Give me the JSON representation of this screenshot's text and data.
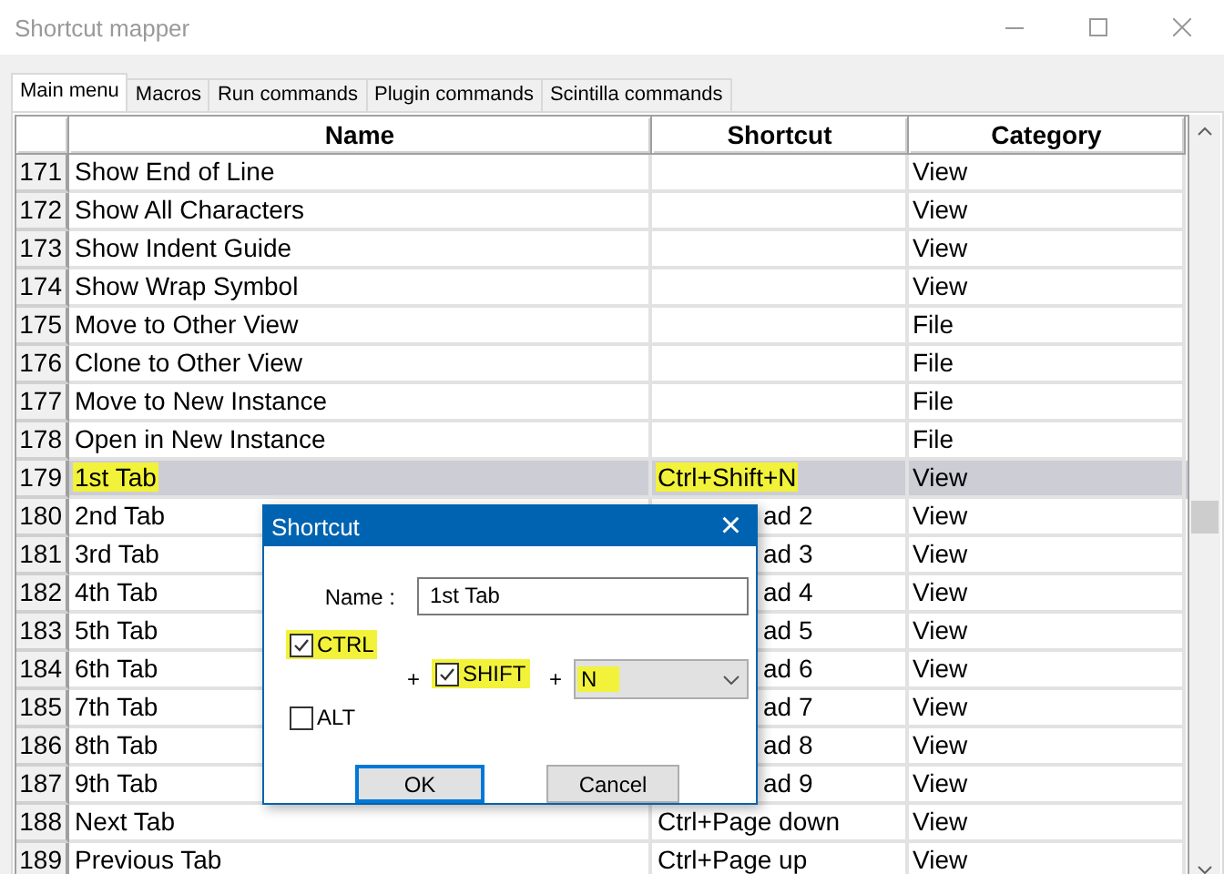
{
  "window": {
    "title": "Shortcut mapper"
  },
  "tabs": [
    {
      "label": "Main menu",
      "selected": true
    },
    {
      "label": "Macros",
      "selected": false
    },
    {
      "label": "Run commands",
      "selected": false
    },
    {
      "label": "Plugin commands",
      "selected": false
    },
    {
      "label": "Scintilla commands",
      "selected": false
    }
  ],
  "table": {
    "columns": [
      "Name",
      "Shortcut",
      "Category"
    ],
    "rows": [
      {
        "number": "171",
        "name": "Show End of Line",
        "shortcut": "",
        "category": "View",
        "selected": false,
        "highlighted": false,
        "covered": false
      },
      {
        "number": "172",
        "name": "Show All Characters",
        "shortcut": "",
        "category": "View",
        "selected": false,
        "highlighted": false,
        "covered": false
      },
      {
        "number": "173",
        "name": "Show Indent Guide",
        "shortcut": "",
        "category": "View",
        "selected": false,
        "highlighted": false,
        "covered": false
      },
      {
        "number": "174",
        "name": "Show Wrap Symbol",
        "shortcut": "",
        "category": "View",
        "selected": false,
        "highlighted": false,
        "covered": false
      },
      {
        "number": "175",
        "name": "Move to Other View",
        "shortcut": "",
        "category": "File",
        "selected": false,
        "highlighted": false,
        "covered": false
      },
      {
        "number": "176",
        "name": "Clone to Other View",
        "shortcut": "",
        "category": "File",
        "selected": false,
        "highlighted": false,
        "covered": false
      },
      {
        "number": "177",
        "name": "Move to New Instance",
        "shortcut": "",
        "category": "File",
        "selected": false,
        "highlighted": false,
        "covered": false
      },
      {
        "number": "178",
        "name": "Open in New Instance",
        "shortcut": "",
        "category": "File",
        "selected": false,
        "highlighted": false,
        "covered": false
      },
      {
        "number": "179",
        "name": "1st Tab",
        "shortcut": "Ctrl+Shift+N",
        "category": "View",
        "selected": true,
        "highlighted": true,
        "covered": false
      },
      {
        "number": "180",
        "name": "2nd Tab",
        "shortcut": "ad 2",
        "category": "View",
        "selected": false,
        "highlighted": false,
        "covered": true
      },
      {
        "number": "181",
        "name": "3rd Tab",
        "shortcut": "ad 3",
        "category": "View",
        "selected": false,
        "highlighted": false,
        "covered": true
      },
      {
        "number": "182",
        "name": "4th Tab",
        "shortcut": "ad 4",
        "category": "View",
        "selected": false,
        "highlighted": false,
        "covered": true
      },
      {
        "number": "183",
        "name": "5th Tab",
        "shortcut": "ad 5",
        "category": "View",
        "selected": false,
        "highlighted": false,
        "covered": true
      },
      {
        "number": "184",
        "name": "6th Tab",
        "shortcut": "ad 6",
        "category": "View",
        "selected": false,
        "highlighted": false,
        "covered": true
      },
      {
        "number": "185",
        "name": "7th Tab",
        "shortcut": "ad 7",
        "category": "View",
        "selected": false,
        "highlighted": false,
        "covered": true
      },
      {
        "number": "186",
        "name": "8th Tab",
        "shortcut": "ad 8",
        "category": "View",
        "selected": false,
        "highlighted": false,
        "covered": true
      },
      {
        "number": "187",
        "name": "9th Tab",
        "shortcut": "ad 9",
        "category": "View",
        "selected": false,
        "highlighted": false,
        "covered": true
      },
      {
        "number": "188",
        "name": "Next Tab",
        "shortcut": "Ctrl+Page down",
        "category": "View",
        "selected": false,
        "highlighted": false,
        "covered": false
      },
      {
        "number": "189",
        "name": "Previous Tab",
        "shortcut": "Ctrl+Page up",
        "category": "View",
        "selected": false,
        "highlighted": false,
        "covered": false
      }
    ]
  },
  "dialog": {
    "title": "Shortcut",
    "close": "×",
    "name_label": "Name :",
    "name_value": "1st Tab",
    "modifiers": [
      {
        "label": "CTRL",
        "checked": true,
        "highlighted": true
      },
      {
        "label": "SHIFT",
        "checked": true,
        "highlighted": true
      },
      {
        "label": "ALT",
        "checked": false,
        "highlighted": false
      }
    ],
    "plus_signs": [
      "+",
      "+"
    ],
    "key": {
      "value": "N",
      "highlighted": true
    },
    "buttons": [
      "OK",
      "Cancel"
    ]
  }
}
